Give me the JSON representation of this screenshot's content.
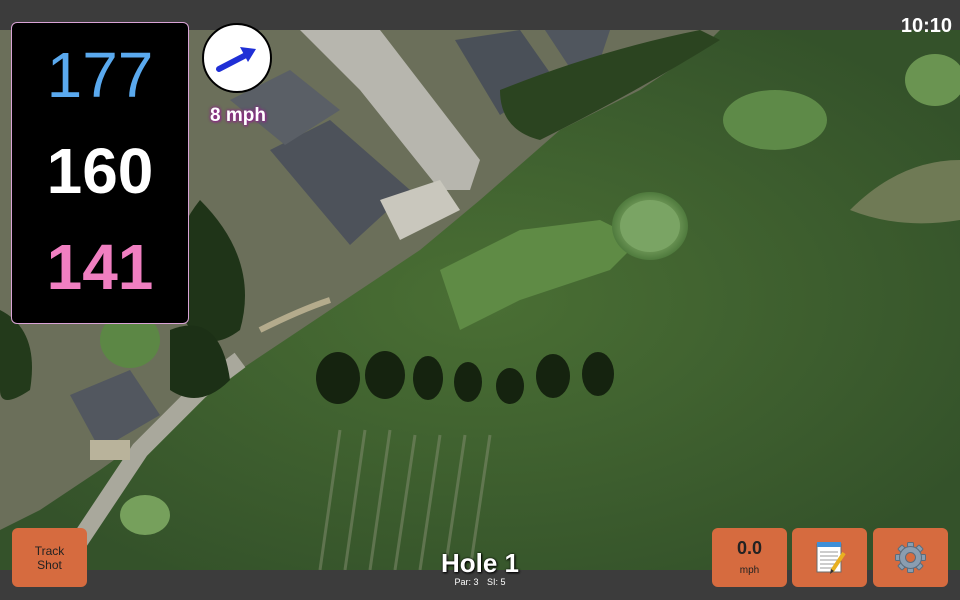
{
  "status_bar": {
    "time": "10:10"
  },
  "distances": {
    "back": "177",
    "middle": "160",
    "front": "141",
    "colors": {
      "back": "#5aa9ee",
      "middle": "#ffffff",
      "front": "#f07fc1"
    }
  },
  "wind": {
    "icon": "wind-direction-arrow-icon",
    "speed": "8 mph"
  },
  "hole": {
    "title": "Hole 1",
    "par": "Par: 3",
    "stroke_index": "SI: 5"
  },
  "buttons": {
    "track_shot_line1": "Track",
    "track_shot_line2": "Shot",
    "speed_value": "0.0",
    "speed_unit": "mph",
    "notes_icon": "notepad-icon",
    "settings_icon": "gear-icon"
  },
  "colors": {
    "button_orange": "#d66b3f",
    "panel_border": "#d9a3d6",
    "bar_gray": "#3c3c3c"
  }
}
